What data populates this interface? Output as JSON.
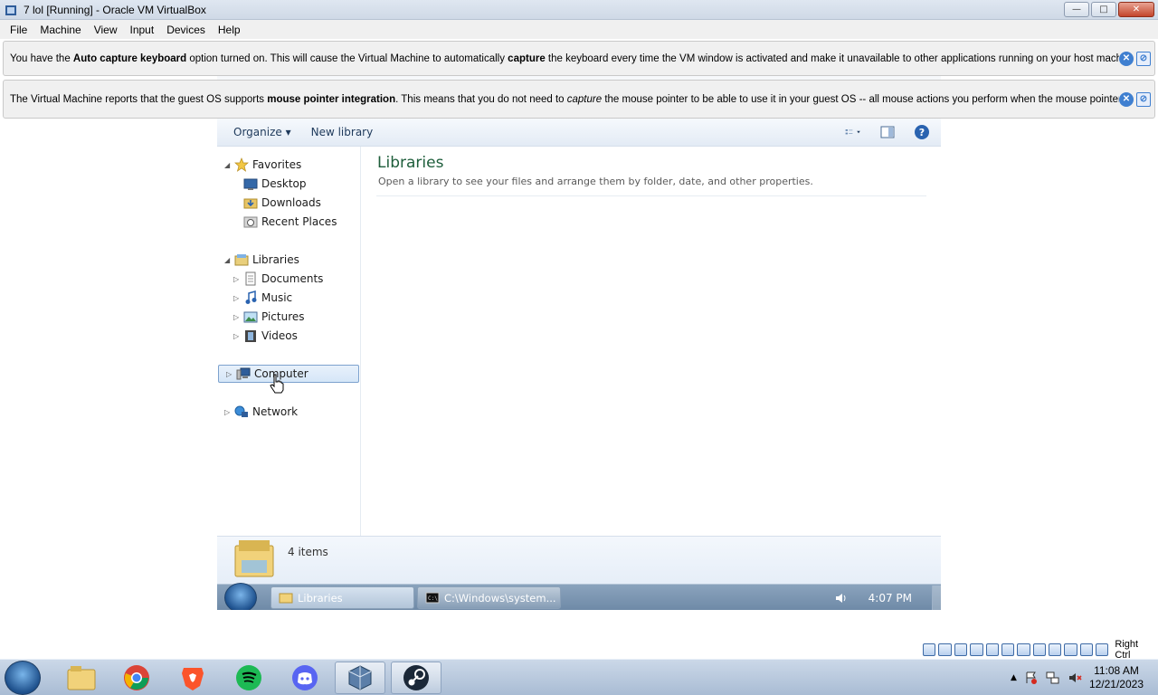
{
  "host_window": {
    "title": "7 lol [Running] - Oracle VM VirtualBox",
    "controls": {
      "minimize": "—",
      "maximize": "□",
      "close": "✕"
    }
  },
  "menubar": {
    "items": [
      "File",
      "Machine",
      "View",
      "Input",
      "Devices",
      "Help"
    ]
  },
  "notices": [
    {
      "t1": "You have the ",
      "b1": "Auto capture keyboard",
      "t2": " option turned on. This will cause the Virtual Machine to automatically ",
      "b2": "capture",
      "t3": " the keyboard every time the VM window is activated and make it unavailable to other applications running on your host machine:"
    },
    {
      "t1": "The Virtual Machine reports that the guest OS supports ",
      "b1": "mouse pointer integration",
      "t2": ". This means that you do not need to ",
      "i1": "capture",
      "t3": " the mouse pointer to be able to use it in your guest OS -- all mouse actions you perform when the mouse pointer is over"
    }
  ],
  "explorer": {
    "toolbar": {
      "organize": "Organize ▾",
      "new_library": "New library"
    },
    "nav": {
      "favorites": "Favorites",
      "desktop": "Desktop",
      "downloads": "Downloads",
      "recent": "Recent Places",
      "libraries": "Libraries",
      "documents": "Documents",
      "music": "Music",
      "pictures": "Pictures",
      "videos": "Videos",
      "computer": "Computer",
      "network": "Network"
    },
    "content": {
      "title": "Libraries",
      "description": "Open a library to see your files and arrange them by folder, date, and other properties."
    },
    "details": {
      "count": "4 items"
    }
  },
  "guest_taskbar": {
    "tasks": [
      "Libraries",
      "C:\\Windows\\system..."
    ],
    "clock": "4:07 PM"
  },
  "vb_status": {
    "host_key": "Right Ctrl"
  },
  "host_taskbar": {
    "time": "11:08 AM",
    "date": "12/21/2023"
  },
  "colors": {
    "explorer_title": "#1e5e3b",
    "selection_border": "#7da2ce",
    "notice_button": "#3f7fd0"
  }
}
